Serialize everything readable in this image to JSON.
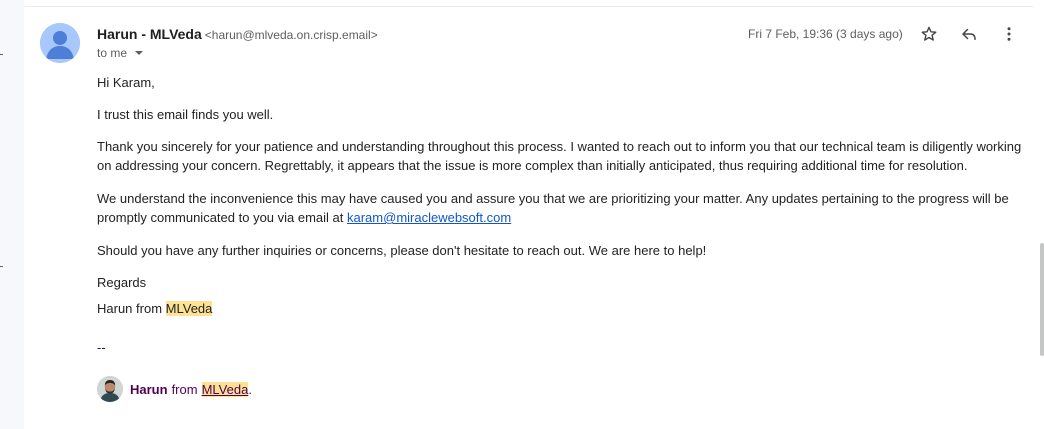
{
  "sender": {
    "name": "Harun - MLVeda",
    "email": "<harun@mlveda.on.crisp.email>",
    "to": "to me"
  },
  "date": "Fri 7 Feb, 19:36 (3 days ago)",
  "icons": {
    "avatar": "person-avatar-icon",
    "star": "star-icon",
    "reply": "reply-icon",
    "more": "more-vert-icon",
    "to_caret": "caret-down-icon"
  },
  "body": {
    "greeting": "Hi Karam,",
    "trust": "I trust this email finds you well.",
    "thanks": "Thank you sincerely for your patience and understanding throughout this process. I wanted to reach out to inform you that our technical team is diligently working on addressing your concern. Regrettably, it appears that the issue is more complex than initially anticipated, thus requiring additional time for resolution.",
    "understand_prefix": "We understand the inconvenience this may have caused you and assure you that we are prioritizing your matter. Any updates pertaining to the progress will be promptly communicated to you via email at ",
    "understand_link": "karam@miraclewebsoft.com",
    "should": "Should you have any further inquiries or concerns, please don't hesitate to reach out. We are here to help!",
    "regards": "Regards",
    "harun_from": "Harun from ",
    "harun_brand": "MLVeda",
    "dashes": "--"
  },
  "signature": {
    "name": "Harun",
    "from": "from",
    "brand": "MLVeda",
    "dot": "."
  },
  "colors": {
    "highlight": "#fde293",
    "link": "#1155cc",
    "signature": "#500050",
    "avatar_bg": "#a8c7fa"
  }
}
